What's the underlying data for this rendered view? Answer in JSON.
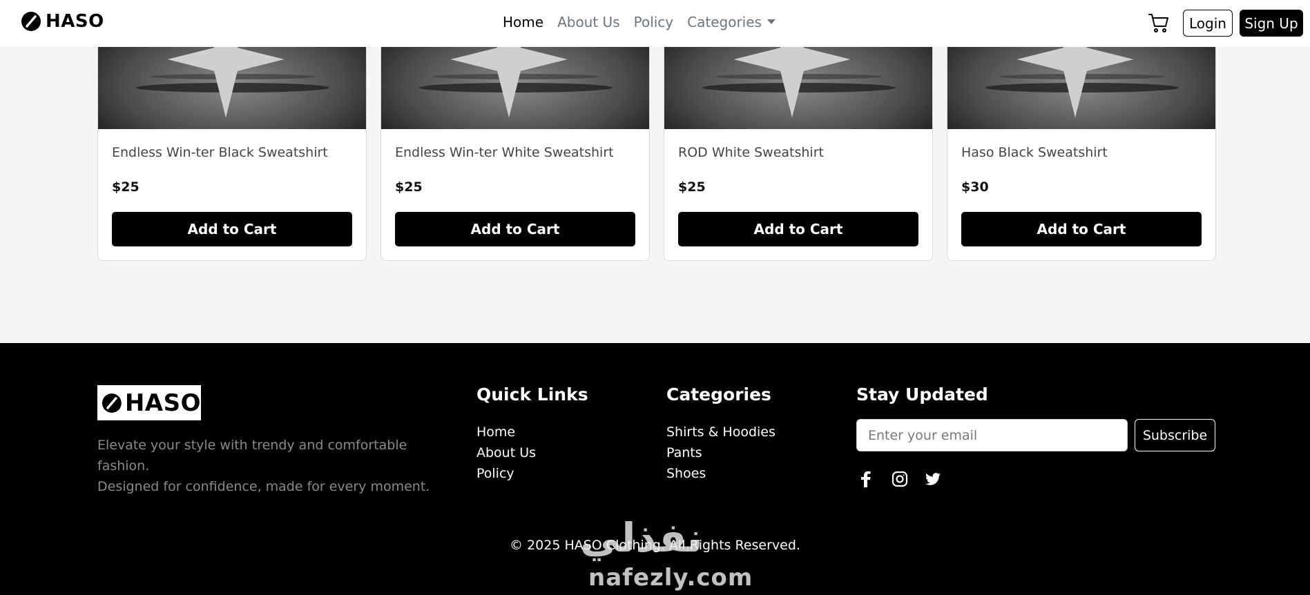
{
  "nav": {
    "brand": "HASO",
    "links": [
      "Home",
      "About Us",
      "Policy",
      "Categories"
    ],
    "login_label": "Login",
    "signup_label": "Sign Up"
  },
  "products": [
    {
      "title": "Endless Win-ter Black Sweatshirt",
      "price": "$25",
      "button": "Add to Cart",
      "shirt_color": "#1a1a1a"
    },
    {
      "title": "Endless Win-ter White Sweatshirt",
      "price": "$25",
      "button": "Add to Cart",
      "shirt_color": "#d8d8d8"
    },
    {
      "title": "ROD White Sweatshirt",
      "price": "$25",
      "button": "Add to Cart",
      "shirt_color": "#d8d8d8"
    },
    {
      "title": "Haso Black Sweatshirt",
      "price": "$30",
      "button": "Add to Cart",
      "shirt_color": "#1a1a1a"
    }
  ],
  "footer": {
    "brand": "HASO",
    "description_line1": "Elevate your style with trendy and comfortable fashion.",
    "description_line2": "Designed for confidence, made for every moment.",
    "quick_links_title": "Quick Links",
    "quick_links": [
      "Home",
      "About Us",
      "Policy"
    ],
    "categories_title": "Categories",
    "categories": [
      "Shirts & Hoodies",
      "Pants",
      "Shoes"
    ],
    "stay_updated_title": "Stay Updated",
    "email_placeholder": "Enter your email",
    "subscribe_label": "Subscribe",
    "social_icons": [
      "facebook-icon",
      "instagram-icon",
      "twitter-icon"
    ],
    "copyright": "© 2025 HASO Clothing. All Rights Reserved."
  },
  "watermark": {
    "arabic": "نفذلي",
    "latin": "nafezly.com"
  }
}
